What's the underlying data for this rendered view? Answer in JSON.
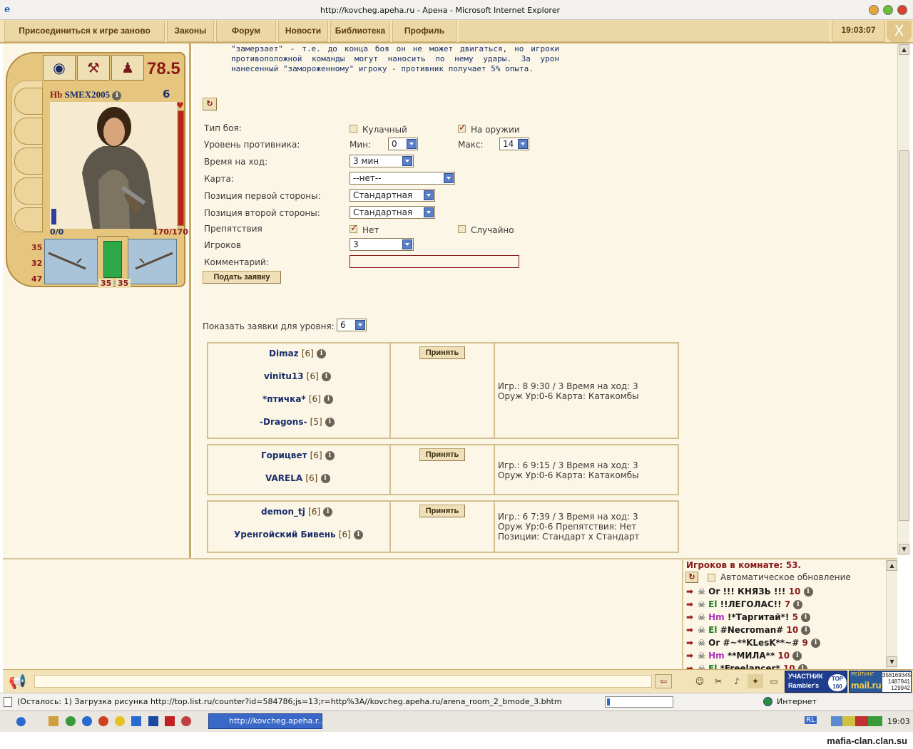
{
  "window": {
    "title": "http://kovcheg.apeha.ru - Арена - Microsoft Internet Explorer"
  },
  "menu": {
    "items": [
      "Присоединиться к игре заново",
      "Законы",
      "Форум",
      "Новости",
      "Библиотека",
      "Профиль"
    ],
    "clock": "19:03:07",
    "exit": "X"
  },
  "character": {
    "race": "Hb",
    "name": "SMEX2005",
    "level": "6",
    "score": "78.5",
    "mana": "0/0",
    "hp": "170/170",
    "stats": [
      "35",
      "32",
      "47"
    ],
    "armor_left": "35",
    "armor_right": "35",
    "hp_fraction": 1.0
  },
  "info_text": "\"замерзает\" - т.е. до конца боя он не может двигаться, но игроки противоположной команды могут наносить по нему удары. За урон нанесенный \"замороженному\" игроку - противник получает 5% опыта.",
  "form": {
    "fight_type_label": "Тип боя:",
    "fight_type_fist": "Кулачный",
    "fight_type_weapon": "На оружии",
    "fight_type_weapon_checked": true,
    "opponent_level_label": "Уровень противника:",
    "min_label": "Мин:",
    "min_value": "0",
    "max_label": "Макс:",
    "max_value": "14",
    "turn_time_label": "Время на ход:",
    "turn_time_value": "3 мин",
    "map_label": "Карта:",
    "map_value": "--нет--",
    "pos1_label": "Позиция первой стороны:",
    "pos1_value": "Стандартная",
    "pos2_label": "Позиция второй стороны:",
    "pos2_value": "Стандартная",
    "obstacles_label": "Препятствия",
    "obstacles_none": "Нет",
    "obstacles_random": "Случайно",
    "obstacles_none_checked": true,
    "players_label": "Игроков",
    "players_value": "3",
    "comment_label": "Комментарий:",
    "comment_value": "",
    "submit_label": "Подать заявку",
    "show_label": "Показать заявки для уровня:",
    "show_value": "6"
  },
  "bids": [
    {
      "players": [
        {
          "name": "Dimaz",
          "level": "[6]"
        },
        {
          "name": "vinitu13",
          "level": "[6]"
        },
        {
          "name": "*птичка*",
          "level": "[6]"
        },
        {
          "name": "-Dragons-",
          "level": "[5]"
        }
      ],
      "accept_label": "Принять",
      "info_line1": "Игр.: 8  9:30 / 3   Время на ход: 3",
      "info_line2": "Оруж   Ур:0-6   Карта: Катакомбы",
      "info_line3": ""
    },
    {
      "players": [
        {
          "name": "Горицвет",
          "level": "[6]"
        },
        {
          "name": "VARELA",
          "level": "[6]"
        }
      ],
      "accept_label": "Принять",
      "info_line1": "Игр.: 6  9:15 / 3   Время на ход: 3",
      "info_line2": "Оруж   Ур:0-6   Карта: Катакомбы",
      "info_line3": ""
    },
    {
      "players": [
        {
          "name": "demon_tj",
          "level": "[6]"
        },
        {
          "name": "Уренгойский Бивень",
          "level": "[6]"
        }
      ],
      "accept_label": "Принять",
      "info_line1": "Игр.: 6  7:39 / 3   Время на ход: 3",
      "info_line2": "Оруж   Ур:0-6   Препятствия: Нет",
      "info_line3": "Позиции: Стандарт x Стандарт"
    }
  ],
  "room": {
    "count_label": "Игроков в комнате: 53.",
    "auto_refresh_label": "Автоматическое обновление",
    "players": [
      {
        "race": "Or",
        "name": "!!! КНЯЗЬ !!!",
        "level": "10",
        "race_color": "#1a1a1a"
      },
      {
        "race": "El",
        "name": "!!ЛЕГОЛАС!!",
        "level": "7",
        "race_color": "#1a7a1a"
      },
      {
        "race": "Hm",
        "name": "!*Таргитай*!",
        "level": "5",
        "race_color": "#b030c0"
      },
      {
        "race": "El",
        "name": "#Necroman#",
        "level": "10",
        "race_color": "#1a7a1a"
      },
      {
        "race": "Or",
        "name": "#~**KLesK**~#",
        "level": "9",
        "race_color": "#1a1a1a"
      },
      {
        "race": "Hm",
        "name": "**МИЛА**",
        "level": "10",
        "race_color": "#b030c0"
      },
      {
        "race": "El",
        "name": "*Freelancer*",
        "level": "10",
        "race_color": "#1a7a1a"
      }
    ]
  },
  "badges": {
    "rambler_top": "УЧАСТНИК",
    "rambler_name": "Rambler's",
    "rambler_num": "TOP 100",
    "mail_label": "РЕЙТИНГ",
    "mail_brand": "mail.ru",
    "mail_nums": [
      "358169345",
      "1487941",
      "129942"
    ]
  },
  "status": {
    "text": "(Осталось: 1) Загрузка рисунка http://top.list.ru/counter?id=584786;js=13;r=http%3A//kovcheg.apeha.ru/arena_room_2_bmode_3.bhtm",
    "zone": "Интернет"
  },
  "taskbar": {
    "task_label": "http://kovcheg.apeha.r...",
    "lang": "RL",
    "time": "19:03"
  },
  "watermark": "mafia-clan.clan.su"
}
